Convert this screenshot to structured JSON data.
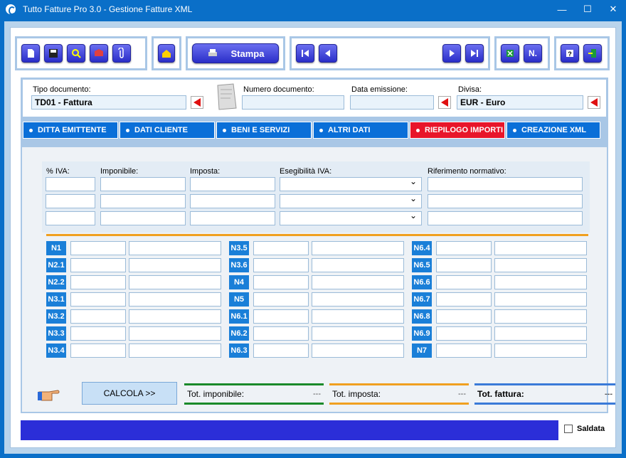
{
  "window": {
    "title": "Tutto Fatture Pro 3.0 - Gestione Fatture XML",
    "minimize": "—",
    "maximize": "☐",
    "close": "✕"
  },
  "toolbar": {
    "stampa_label": "Stampa",
    "n_label": "N."
  },
  "fields": {
    "tipo_label": "Tipo documento:",
    "tipo_value": "TD01 - Fattura",
    "numero_label": "Numero documento:",
    "numero_value": "",
    "data_label": "Data emissione:",
    "data_value": "",
    "divisa_label": "Divisa:",
    "divisa_value": "EUR - Euro"
  },
  "tabs": [
    "DITTA EMITTENTE",
    "DATI CLIENTE",
    "BENI E SERVIZI",
    "ALTRI DATI",
    "RIEPILOGO IMPORTI",
    "CREAZIONE XML"
  ],
  "active_tab": "RIEPILOGO IMPORTI",
  "riepilogo": {
    "col_iva": "% IVA:",
    "col_imponibile": "Imponibile:",
    "col_imposta": "Imposta:",
    "col_esigibilita": "Esegibilità IVA:",
    "col_riferimento": "Riferimento normativo:"
  },
  "nature": {
    "col1": [
      "N1",
      "N2.1",
      "N2.2",
      "N3.1",
      "N3.2",
      "N3.3",
      "N3.4"
    ],
    "col2": [
      "N3.5",
      "N3.6",
      "N4",
      "N5",
      "N6.1",
      "N6.2",
      "N6.3"
    ],
    "col3": [
      "N6.4",
      "N6.5",
      "N6.6",
      "N6.7",
      "N6.8",
      "N6.9",
      "N7"
    ]
  },
  "totals": {
    "calcola_label": "CALCOLA  >>",
    "imponibile_label": "Tot. imponibile:",
    "imponibile_value": "---",
    "imposta_label": "Tot. imposta:",
    "imposta_value": "---",
    "fattura_label": "Tot. fattura:",
    "fattura_value": "---"
  },
  "footer": {
    "saldata_label": "Saldata"
  },
  "colors": {
    "tab": "#0a6fd8",
    "active_tab": "#e8152a",
    "green": "#1a8a2a",
    "orange": "#f0a020",
    "blue": "#3a7ad8"
  }
}
